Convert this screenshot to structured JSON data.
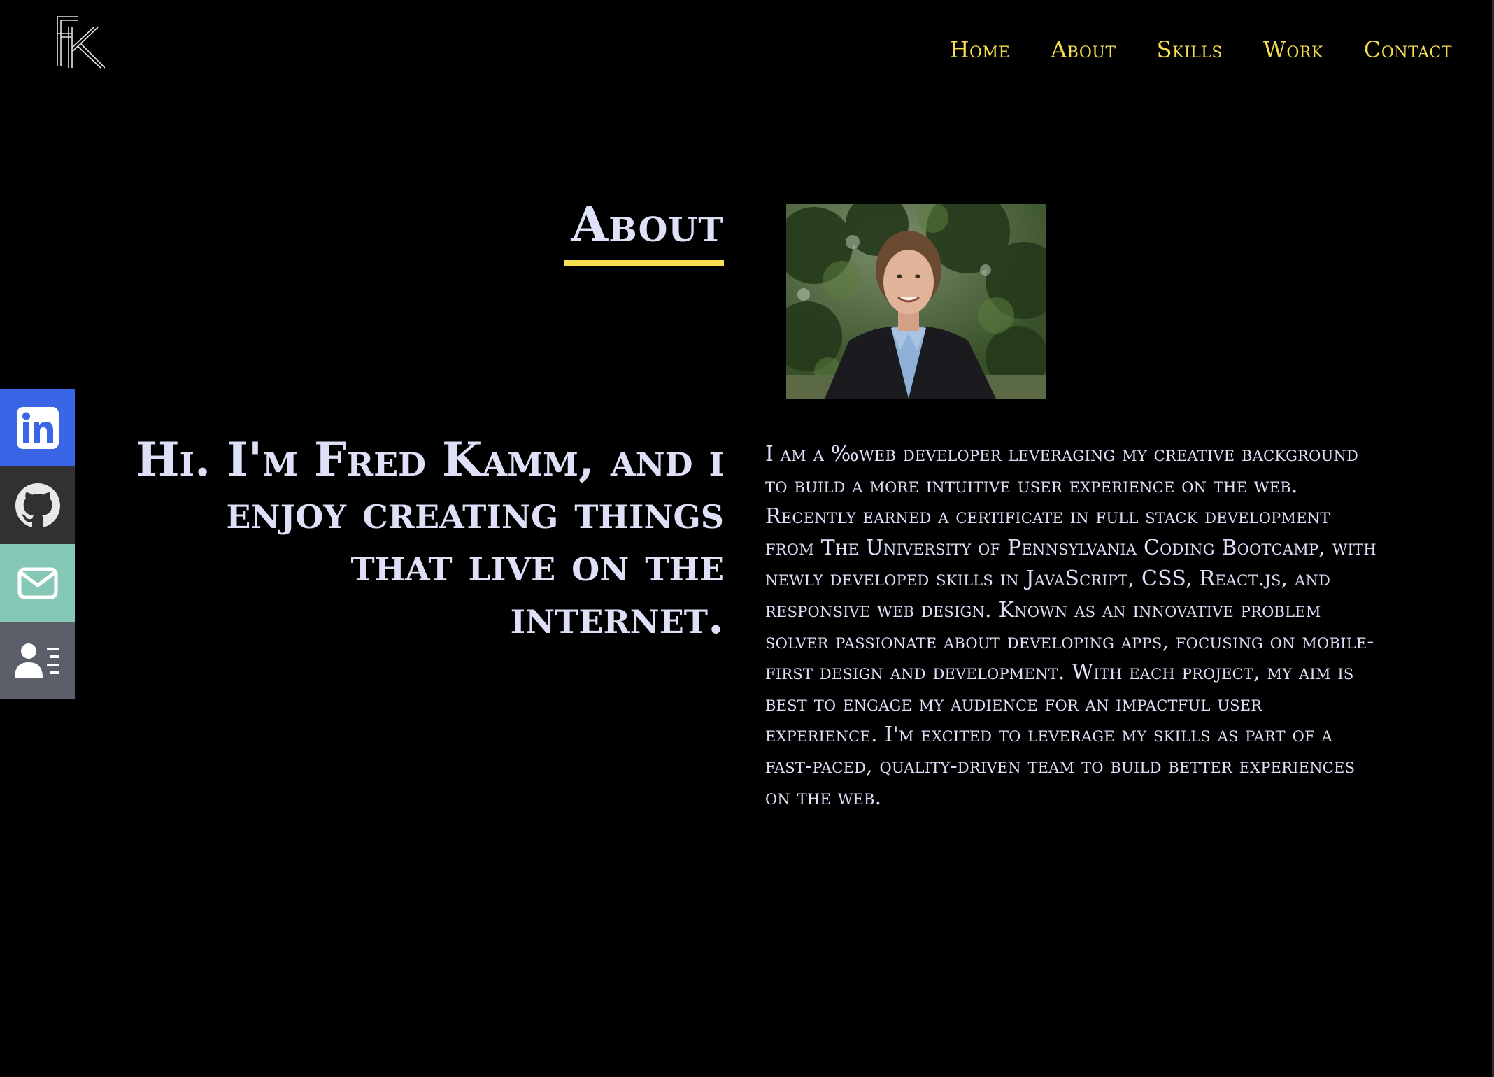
{
  "logo": {
    "monogram": "FK"
  },
  "nav": {
    "items": [
      {
        "label": "Home"
      },
      {
        "label": "About"
      },
      {
        "label": "Skills"
      },
      {
        "label": "Work"
      },
      {
        "label": "Contact"
      }
    ]
  },
  "about": {
    "heading": "About",
    "intro": "Hi. I'm Fred Kamm, and i enjoy creating things that live on the internet.",
    "bio": "I am a ‰web developer leveraging my creative background to build a more intuitive user experience on the web. Recently earned a certificate in full stack development from The University of Pennsylvania Coding Bootcamp, with newly developed skills in JavaScript, CSS, React.js, and responsive web design. Known as an innovative problem solver passionate about developing apps, focusing on mobile-first design and development. With each project, my aim is best to engage my audience for an impactful user experience. I'm excited to leverage my skills as part of a fast-paced, quality-driven team to build better experiences on the web."
  },
  "social": {
    "items": [
      {
        "icon": "linkedin-icon",
        "color": "#3a65e6"
      },
      {
        "icon": "github-icon",
        "color": "#313131"
      },
      {
        "icon": "mail-icon",
        "color": "#86c8b6"
      },
      {
        "icon": "contact-card-icon",
        "color": "#5a5f69"
      }
    ]
  },
  "theme": {
    "background": "#000000",
    "accent": "#f7df52",
    "text": "#dde0f7"
  }
}
